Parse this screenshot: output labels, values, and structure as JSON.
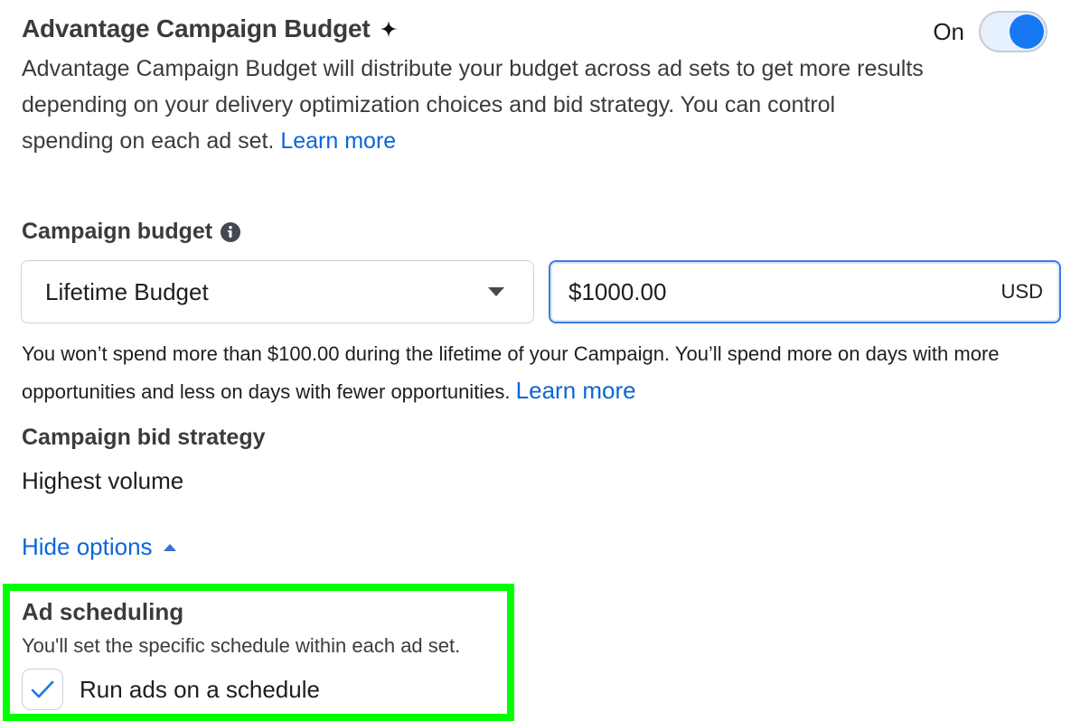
{
  "advantage": {
    "title": "Advantage Campaign Budget",
    "title_icon": "sparkle-icon",
    "description": "Advantage Campaign Budget will distribute your budget across ad sets to get more results depending on your delivery optimization choices and bid strategy. You can control spending on each ad set.",
    "learn_more": "Learn more",
    "toggle_label": "On",
    "toggle_state": "on",
    "accent_color": "#1877f2"
  },
  "budget": {
    "label": "Campaign budget",
    "label_icon": "info-icon",
    "type_selected": "Lifetime Budget",
    "type_icon": "caret-down-icon",
    "amount": "$1000.00",
    "currency": "USD",
    "note": "You won’t spend more than $100.00 during the lifetime of your Campaign. You’ll spend more on days with more opportunities and less on days with fewer opportunities.",
    "learn_more": "Learn more"
  },
  "bid_strategy": {
    "label": "Campaign bid strategy",
    "value": "Highest volume"
  },
  "options_toggle": {
    "label": "Hide options",
    "icon": "caret-up-icon"
  },
  "ad_scheduling": {
    "title": "Ad scheduling",
    "description": "You'll set the specific schedule within each ad set.",
    "checkbox_label": "Run ads on a schedule",
    "checked": true,
    "highlight_color": "#00ff00"
  }
}
